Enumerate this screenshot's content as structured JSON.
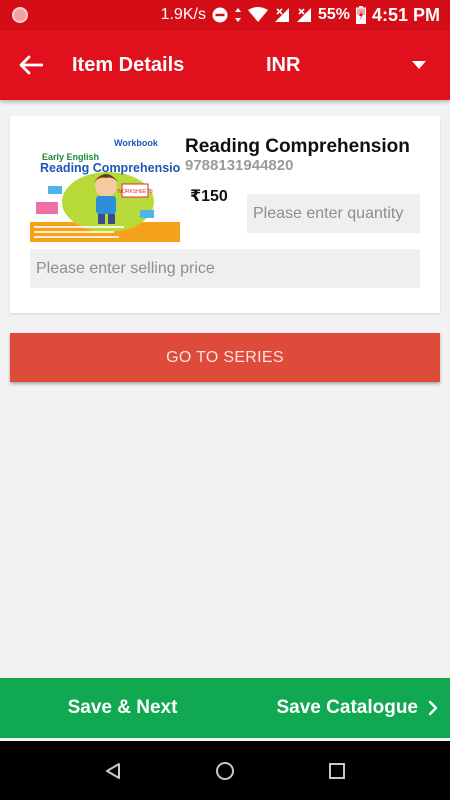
{
  "status_bar": {
    "speed": "1.9K/s",
    "battery": "55%",
    "time": "4:51 PM"
  },
  "app_bar": {
    "title": "Item Details",
    "currency": "INR"
  },
  "item": {
    "title": "Reading Comprehension",
    "isbn": "9788131944820",
    "price": "₹150",
    "cover": {
      "publisher": "Workbook",
      "series": "Early English",
      "title": "Reading Comprehension"
    }
  },
  "inputs": {
    "quantity_placeholder": "Please enter quantity",
    "selling_price_placeholder": "Please enter selling price"
  },
  "buttons": {
    "go_to_series": "GO TO SERIES",
    "save_next": "Save & Next",
    "save_catalogue": "Save Catalogue"
  },
  "colors": {
    "status_bar": "#d50d16",
    "app_bar": "#e0101c",
    "series_button": "#df4b3b",
    "bottom_bar": "#10a951"
  }
}
